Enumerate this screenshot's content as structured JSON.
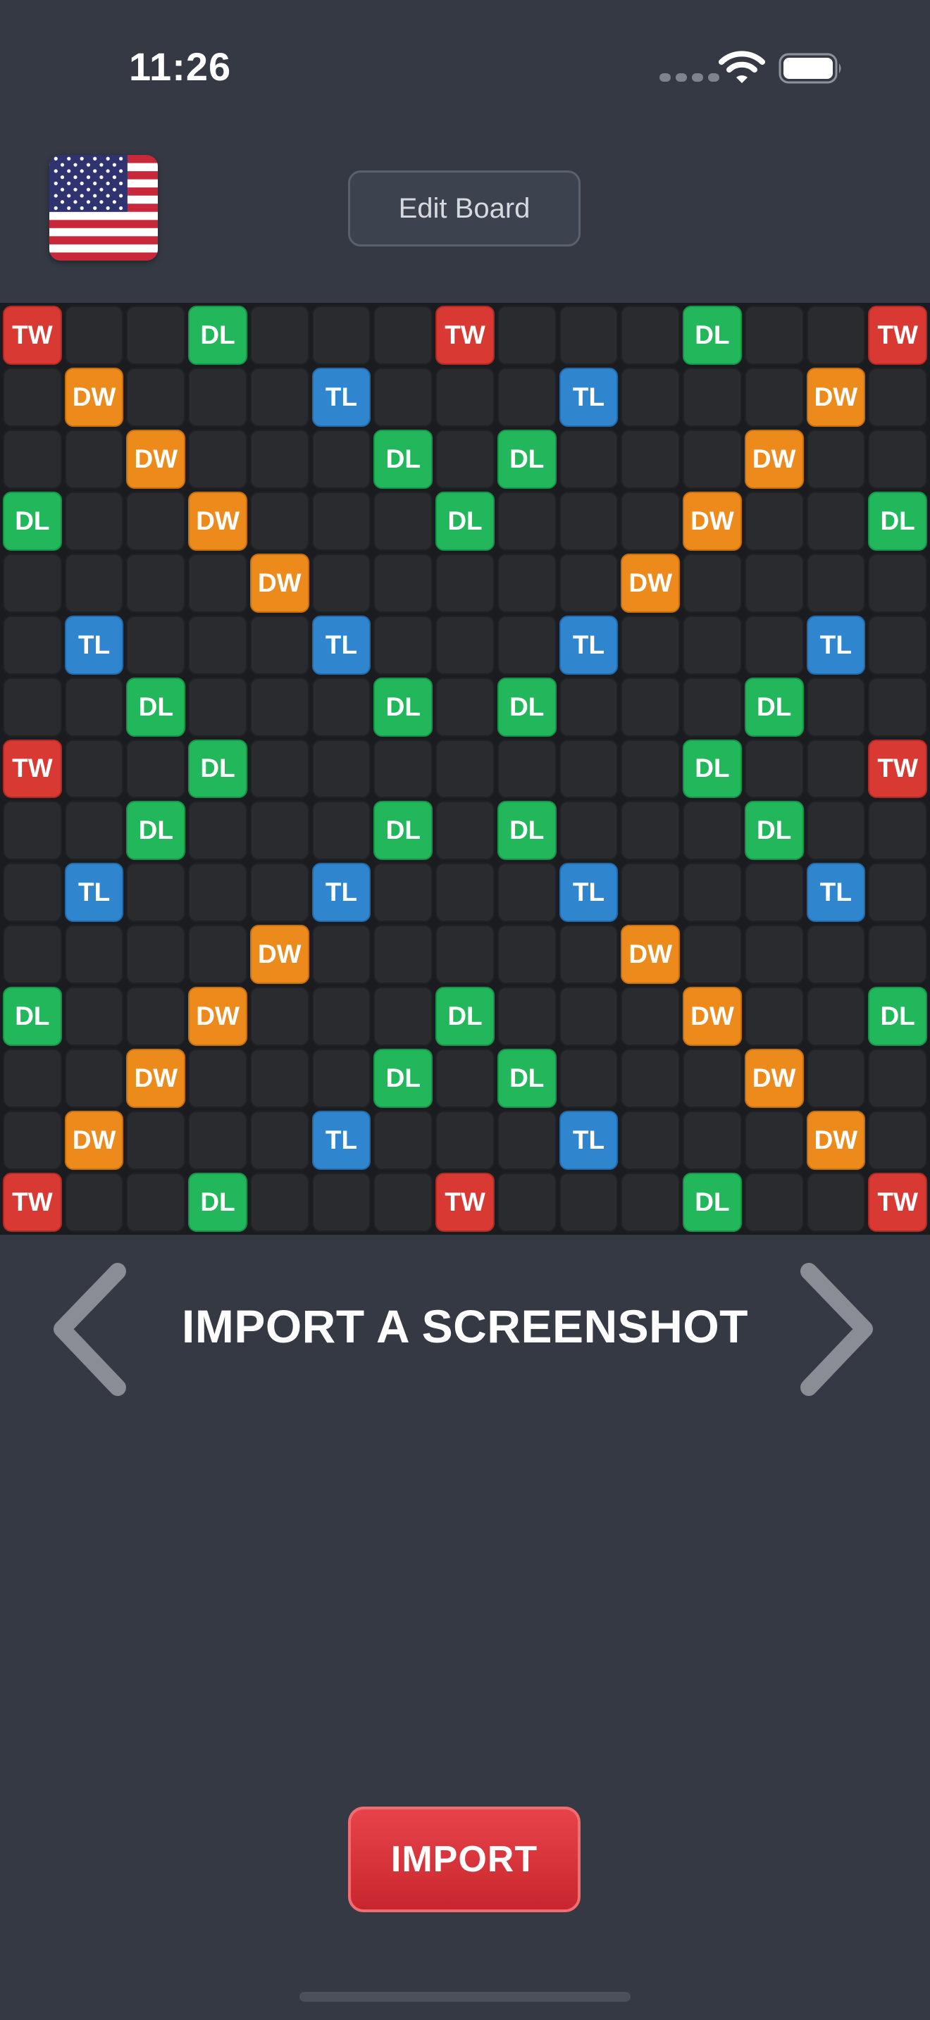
{
  "status_bar": {
    "time": "11:26",
    "icons": [
      "cellular-signal-icon",
      "wifi-icon",
      "battery-icon"
    ]
  },
  "header": {
    "flag_icon": "us-flag-icon",
    "edit_board_label": "Edit Board"
  },
  "board": {
    "size": 15,
    "colors": {
      "TW": "#d83a33",
      "DW": "#ec8a1c",
      "DL": "#23b75c",
      "TL": "#2f86cf",
      "empty": "#2a2b2e"
    },
    "rows": [
      [
        "TW",
        "",
        "",
        "DL",
        "",
        "",
        "",
        "TW",
        "",
        "",
        "",
        "DL",
        "",
        "",
        "TW"
      ],
      [
        "",
        "DW",
        "",
        "",
        "",
        "TL",
        "",
        "",
        "",
        "TL",
        "",
        "",
        "",
        "DW",
        ""
      ],
      [
        "",
        "",
        "DW",
        "",
        "",
        "",
        "DL",
        "",
        "DL",
        "",
        "",
        "",
        "DW",
        "",
        ""
      ],
      [
        "DL",
        "",
        "",
        "DW",
        "",
        "",
        "",
        "DL",
        "",
        "",
        "",
        "DW",
        "",
        "",
        "DL"
      ],
      [
        "",
        "",
        "",
        "",
        "DW",
        "",
        "",
        "",
        "",
        "",
        "DW",
        "",
        "",
        "",
        ""
      ],
      [
        "",
        "TL",
        "",
        "",
        "",
        "TL",
        "",
        "",
        "",
        "TL",
        "",
        "",
        "",
        "TL",
        ""
      ],
      [
        "",
        "",
        "DL",
        "",
        "",
        "",
        "DL",
        "",
        "DL",
        "",
        "",
        "",
        "DL",
        "",
        ""
      ],
      [
        "TW",
        "",
        "",
        "DL",
        "",
        "",
        "",
        "",
        "",
        "",
        "",
        "DL",
        "",
        "",
        "TW"
      ],
      [
        "",
        "",
        "DL",
        "",
        "",
        "",
        "DL",
        "",
        "DL",
        "",
        "",
        "",
        "DL",
        "",
        ""
      ],
      [
        "",
        "TL",
        "",
        "",
        "",
        "TL",
        "",
        "",
        "",
        "TL",
        "",
        "",
        "",
        "TL",
        ""
      ],
      [
        "",
        "",
        "",
        "",
        "DW",
        "",
        "",
        "",
        "",
        "",
        "DW",
        "",
        "",
        "",
        ""
      ],
      [
        "DL",
        "",
        "",
        "DW",
        "",
        "",
        "",
        "DL",
        "",
        "",
        "",
        "DW",
        "",
        "",
        "DL"
      ],
      [
        "",
        "",
        "DW",
        "",
        "",
        "",
        "DL",
        "",
        "DL",
        "",
        "",
        "",
        "DW",
        "",
        ""
      ],
      [
        "",
        "DW",
        "",
        "",
        "",
        "TL",
        "",
        "",
        "",
        "TL",
        "",
        "",
        "",
        "DW",
        ""
      ],
      [
        "TW",
        "",
        "",
        "DL",
        "",
        "",
        "",
        "TW",
        "",
        "",
        "",
        "DL",
        "",
        "",
        "TW"
      ]
    ]
  },
  "navigation": {
    "title": "IMPORT A SCREENSHOT",
    "prev_icon": "chevron-left-icon",
    "next_icon": "chevron-right-icon"
  },
  "import_button_label": "IMPORT"
}
